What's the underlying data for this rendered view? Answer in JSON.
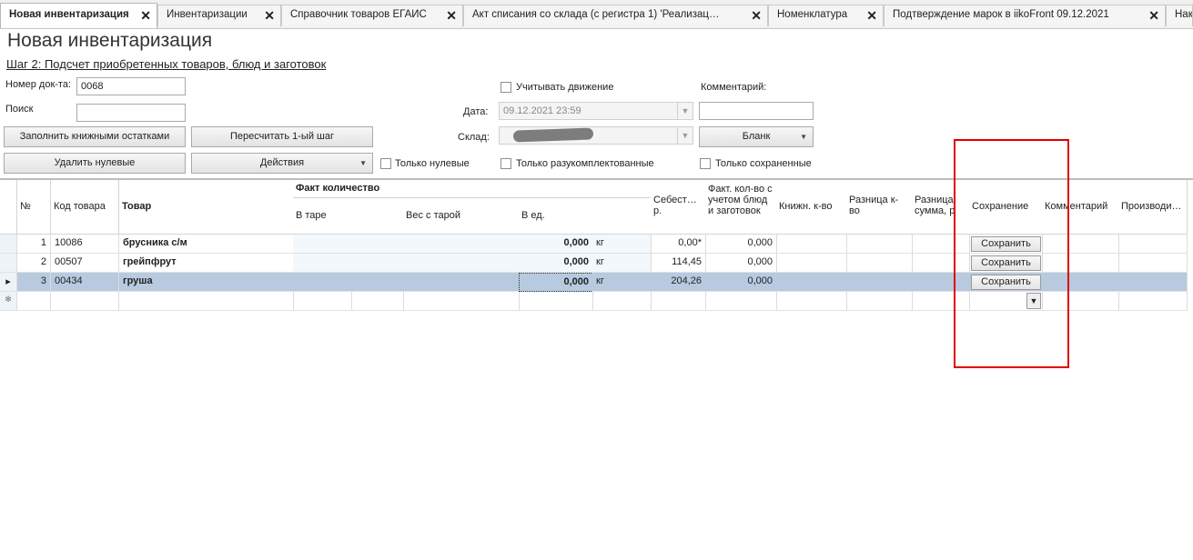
{
  "tabs": [
    {
      "label": "Новая инвентаризация",
      "close": "✕",
      "active": true
    },
    {
      "label": "Инвентаризации",
      "close": "✕"
    },
    {
      "label": "Справочник товаров ЕГАИС",
      "close": "✕"
    },
    {
      "label": "Акт списания со склада (с регистра 1) 'Реализац…",
      "close": "✕"
    },
    {
      "label": "Номенклатура",
      "close": "✕"
    },
    {
      "label": "Подтверждение марок в iikoFront 09.12.2021",
      "close": "✕"
    },
    {
      "label": "Накл"
    }
  ],
  "page": {
    "title": "Новая инвентаризация",
    "step": "Шаг 2: Подсчет приобретенных товаров, блюд и заготовок"
  },
  "form": {
    "doc_num_label": "Номер док-та:",
    "doc_num_value": "0068",
    "search_label": "Поиск",
    "search_value": "",
    "track_movement_label": "Учитывать движение",
    "comment_label": "Комментарий:",
    "comment_value": "",
    "date_label": "Дата:",
    "date_value": "09.12.2021 23:59",
    "warehouse_label": "Склад:",
    "blank_label": "Бланк",
    "fill_book_label": "Заполнить книжными остатками",
    "recalc_label": "Пересчитать 1-ый шаг",
    "delete_zero_label": "Удалить нулевые",
    "actions_label": "Действия",
    "only_zero_label": "Только нулевые",
    "only_disassembled_label": "Только разукомплектованные",
    "only_saved_label": "Только сохраненные"
  },
  "grid": {
    "headers": {
      "num": "№",
      "code": "Код товара",
      "product": "Товар",
      "fact_group": "Факт количество",
      "in_tare": "В таре",
      "weight_with_tare": "Вес с тарой",
      "in_units": "В ед.",
      "cost": "Себест… р.",
      "fact_incl": "Факт. кол-во с учетом блюд и заготовок",
      "book_qty": "Книжн. к-во",
      "diff_qty": "Разница к-во",
      "diff_sum": "Разница сумма, р",
      "saving": "Сохранение",
      "comment": "Комментарий",
      "producer": "Производи…"
    },
    "rows": [
      {
        "num": "1",
        "code": "10086",
        "product": "брусника с/м",
        "units_qty": "0,000",
        "unit": "кг",
        "cost": "0,00*",
        "fact_incl": "0,000",
        "save": "Сохранить"
      },
      {
        "num": "2",
        "code": "00507",
        "product": "грейпфрут",
        "units_qty": "0,000",
        "unit": "кг",
        "cost": "114,45",
        "fact_incl": "0,000",
        "save": "Сохранить"
      },
      {
        "num": "3",
        "code": "00434",
        "product": "груша",
        "units_qty": "0,000",
        "unit": "кг",
        "cost": "204,26",
        "fact_incl": "0,000",
        "save": "Сохранить"
      }
    ],
    "current_row_marker": "▸",
    "new_row_marker": "✻"
  }
}
